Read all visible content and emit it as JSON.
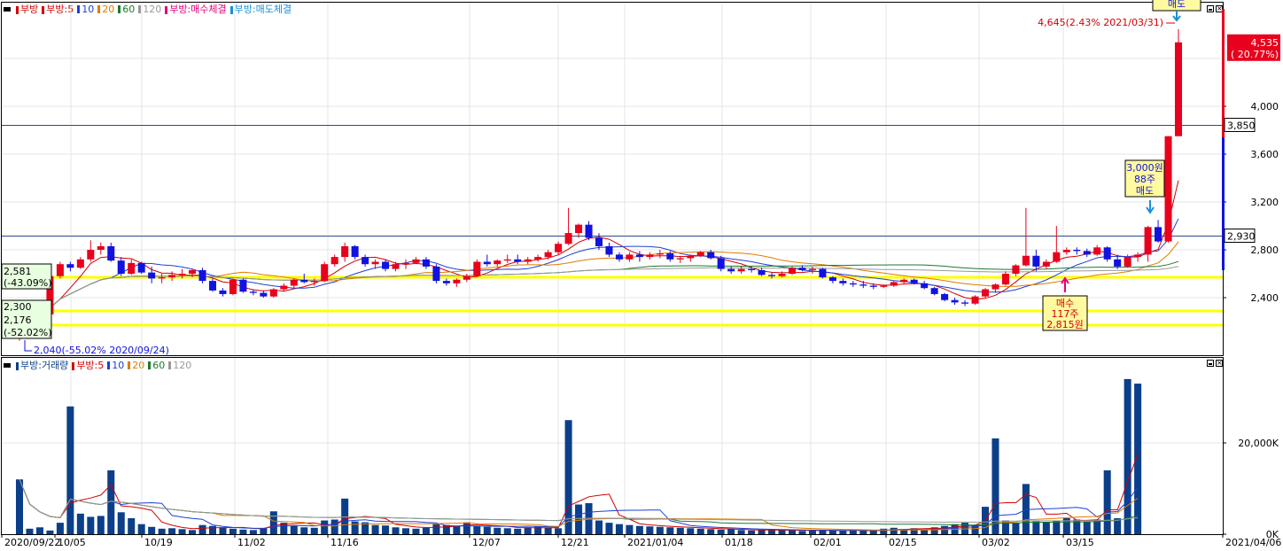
{
  "legend_price": [
    {
      "label": "부방",
      "color": "#d40000"
    },
    {
      "label": "부방:5",
      "color": "#d40000"
    },
    {
      "label": "10",
      "color": "#1d3fd6"
    },
    {
      "label": "20",
      "color": "#e07b00"
    },
    {
      "label": "60",
      "color": "#1a7a2a"
    },
    {
      "label": "120",
      "color": "#999999"
    },
    {
      "label": "부방:매수체결",
      "color": "#e0007a"
    },
    {
      "label": "부방:매도체결",
      "color": "#1a8fd6"
    }
  ],
  "legend_volume": [
    {
      "label": "부방:거래량",
      "color": "#0b3f8a"
    },
    {
      "label": "부방:5",
      "color": "#d40000"
    },
    {
      "label": "10",
      "color": "#1d3fd6"
    },
    {
      "label": "20",
      "color": "#e07b00"
    },
    {
      "label": "60",
      "color": "#1a7a2a"
    },
    {
      "label": "120",
      "color": "#999999"
    }
  ],
  "price_axis": {
    "ticks": [
      "4,000",
      "3,600",
      "3,200",
      "2,800",
      "2,400"
    ]
  },
  "price_markers": {
    "current": {
      "text": "4,535",
      "sub": "( 20.77%)"
    },
    "line1": "3,850",
    "line2": "2,930"
  },
  "left_boxes": [
    {
      "line1": "2,581",
      "line2": "(-43.09%)"
    },
    {
      "line1": "2,300",
      "line2": "2,176",
      "line3": "(-52.02%)"
    }
  ],
  "annotations": {
    "high": "4,645(2.43% 2021/03/31)",
    "low": "2,040(-55.02% 2020/09/24)",
    "sell_top": "매도",
    "sell_mid": [
      "3,000원",
      "88주",
      "매도"
    ],
    "buy": [
      "매수",
      "117주",
      "2,815원"
    ]
  },
  "volume_axis": {
    "ticks": [
      "20,000K",
      "0K"
    ]
  },
  "date_axis": [
    "2020/09/22",
    "10/05",
    "10/19",
    "11/02",
    "11/16",
    "12/07",
    "12/21",
    "2021/01/04",
    "01/18",
    "02/01",
    "02/15",
    "03/02",
    "03/15",
    "2021/04/06"
  ],
  "colors": {
    "up": "#e8001c",
    "down": "#1212e0",
    "vol": "#0b3f8a",
    "yellow": "#ffff00"
  },
  "chart_data": {
    "type": "candlestick",
    "description_units": "KRW",
    "candles": [
      [
        2160,
        2200,
        2040,
        2180
      ],
      [
        2180,
        2260,
        2160,
        2240
      ],
      [
        2240,
        2280,
        2200,
        2260
      ],
      [
        2260,
        2600,
        2250,
        2580
      ],
      [
        2580,
        2700,
        2560,
        2680
      ],
      [
        2680,
        2700,
        2620,
        2650
      ],
      [
        2650,
        2740,
        2640,
        2720
      ],
      [
        2720,
        2880,
        2700,
        2800
      ],
      [
        2800,
        2860,
        2760,
        2830
      ],
      [
        2830,
        2860,
        2700,
        2710
      ],
      [
        2710,
        2740,
        2580,
        2600
      ],
      [
        2600,
        2720,
        2590,
        2690
      ],
      [
        2690,
        2700,
        2600,
        2610
      ],
      [
        2610,
        2660,
        2520,
        2560
      ],
      [
        2560,
        2600,
        2520,
        2570
      ],
      [
        2570,
        2620,
        2540,
        2590
      ],
      [
        2590,
        2640,
        2560,
        2600
      ],
      [
        2600,
        2640,
        2570,
        2630
      ],
      [
        2630,
        2650,
        2520,
        2540
      ],
      [
        2540,
        2560,
        2450,
        2460
      ],
      [
        2460,
        2480,
        2410,
        2430
      ],
      [
        2430,
        2560,
        2420,
        2550
      ],
      [
        2550,
        2560,
        2440,
        2450
      ],
      [
        2450,
        2470,
        2420,
        2440
      ],
      [
        2440,
        2460,
        2400,
        2410
      ],
      [
        2410,
        2480,
        2400,
        2470
      ],
      [
        2470,
        2520,
        2450,
        2500
      ],
      [
        2500,
        2560,
        2470,
        2550
      ],
      [
        2550,
        2600,
        2520,
        2530
      ],
      [
        2530,
        2560,
        2500,
        2540
      ],
      [
        2540,
        2700,
        2530,
        2680
      ],
      [
        2680,
        2760,
        2660,
        2740
      ],
      [
        2740,
        2860,
        2700,
        2830
      ],
      [
        2830,
        2840,
        2720,
        2740
      ],
      [
        2740,
        2760,
        2660,
        2680
      ],
      [
        2680,
        2720,
        2640,
        2700
      ],
      [
        2700,
        2720,
        2620,
        2640
      ],
      [
        2640,
        2700,
        2620,
        2680
      ],
      [
        2680,
        2720,
        2640,
        2690
      ],
      [
        2690,
        2740,
        2680,
        2720
      ],
      [
        2720,
        2740,
        2640,
        2660
      ],
      [
        2660,
        2680,
        2520,
        2540
      ],
      [
        2540,
        2560,
        2500,
        2520
      ],
      [
        2520,
        2560,
        2490,
        2550
      ],
      [
        2550,
        2600,
        2530,
        2580
      ],
      [
        2580,
        2720,
        2570,
        2700
      ],
      [
        2700,
        2760,
        2660,
        2680
      ],
      [
        2680,
        2720,
        2660,
        2710
      ],
      [
        2710,
        2760,
        2690,
        2720
      ],
      [
        2720,
        2760,
        2680,
        2700
      ],
      [
        2700,
        2740,
        2680,
        2720
      ],
      [
        2720,
        2760,
        2700,
        2740
      ],
      [
        2740,
        2800,
        2720,
        2780
      ],
      [
        2780,
        2870,
        2760,
        2850
      ],
      [
        2850,
        3150,
        2840,
        2940
      ],
      [
        2940,
        3020,
        2900,
        3010
      ],
      [
        3010,
        3040,
        2880,
        2900
      ],
      [
        2900,
        2940,
        2800,
        2830
      ],
      [
        2830,
        2860,
        2740,
        2760
      ],
      [
        2760,
        2780,
        2700,
        2720
      ],
      [
        2720,
        2780,
        2700,
        2760
      ],
      [
        2760,
        2790,
        2700,
        2740
      ],
      [
        2740,
        2780,
        2720,
        2760
      ],
      [
        2760,
        2800,
        2730,
        2770
      ],
      [
        2770,
        2790,
        2700,
        2720
      ],
      [
        2720,
        2750,
        2690,
        2730
      ],
      [
        2730,
        2760,
        2700,
        2750
      ],
      [
        2750,
        2790,
        2740,
        2780
      ],
      [
        2780,
        2800,
        2720,
        2730
      ],
      [
        2730,
        2750,
        2620,
        2640
      ],
      [
        2640,
        2660,
        2600,
        2620
      ],
      [
        2620,
        2660,
        2600,
        2640
      ],
      [
        2640,
        2660,
        2610,
        2630
      ],
      [
        2630,
        2650,
        2580,
        2590
      ],
      [
        2590,
        2610,
        2560,
        2580
      ],
      [
        2580,
        2620,
        2570,
        2600
      ],
      [
        2600,
        2660,
        2590,
        2650
      ],
      [
        2650,
        2670,
        2620,
        2630
      ],
      [
        2630,
        2660,
        2600,
        2640
      ],
      [
        2640,
        2650,
        2560,
        2570
      ],
      [
        2570,
        2580,
        2520,
        2540
      ],
      [
        2540,
        2560,
        2500,
        2520
      ],
      [
        2520,
        2540,
        2490,
        2510
      ],
      [
        2510,
        2540,
        2480,
        2500
      ],
      [
        2500,
        2520,
        2470,
        2490
      ],
      [
        2490,
        2510,
        2480,
        2500
      ],
      [
        2500,
        2540,
        2490,
        2530
      ],
      [
        2530,
        2560,
        2510,
        2550
      ],
      [
        2550,
        2560,
        2510,
        2520
      ],
      [
        2520,
        2540,
        2470,
        2480
      ],
      [
        2480,
        2490,
        2420,
        2430
      ],
      [
        2430,
        2440,
        2370,
        2380
      ],
      [
        2380,
        2400,
        2340,
        2360
      ],
      [
        2360,
        2380,
        2330,
        2350
      ],
      [
        2350,
        2420,
        2340,
        2410
      ],
      [
        2410,
        2480,
        2400,
        2470
      ],
      [
        2470,
        2520,
        2440,
        2510
      ],
      [
        2510,
        2620,
        2500,
        2600
      ],
      [
        2600,
        2680,
        2580,
        2670
      ],
      [
        2670,
        3150,
        2660,
        2750
      ],
      [
        2750,
        2800,
        2620,
        2660
      ],
      [
        2660,
        2720,
        2640,
        2700
      ],
      [
        2700,
        3000,
        2690,
        2780
      ],
      [
        2780,
        2820,
        2760,
        2800
      ],
      [
        2800,
        2820,
        2760,
        2790
      ],
      [
        2790,
        2810,
        2740,
        2760
      ],
      [
        2760,
        2840,
        2750,
        2820
      ],
      [
        2820,
        2830,
        2700,
        2720
      ],
      [
        2720,
        2760,
        2640,
        2660
      ],
      [
        2660,
        2760,
        2650,
        2740
      ],
      [
        2740,
        2780,
        2700,
        2760
      ],
      [
        2760,
        3000,
        2700,
        2990
      ],
      [
        2990,
        3050,
        2860,
        2870
      ],
      [
        2870,
        3750,
        2860,
        3750
      ],
      [
        3750,
        4645,
        3920,
        4535
      ]
    ],
    "volume_k": [
      12000,
      1200,
      1500,
      800,
      2500,
      28000,
      4500,
      3800,
      4000,
      14000,
      4800,
      3500,
      2200,
      1600,
      1200,
      1300,
      1100,
      900,
      2000,
      1800,
      1400,
      1200,
      1000,
      900,
      1300,
      5000,
      2500,
      1800,
      1500,
      1400,
      3000,
      3200,
      7800,
      2800,
      2600,
      2000,
      1900,
      1500,
      1300,
      1200,
      1400,
      2200,
      2000,
      1800,
      2600,
      1800,
      1600,
      1400,
      1300,
      1200,
      1500,
      1700,
      1400,
      1300,
      25000,
      6500,
      6800,
      3000,
      2500,
      2200,
      2000,
      1800,
      1700,
      1600,
      1500,
      1400,
      1300,
      1200,
      1100,
      1000,
      1100,
      900,
      800,
      900,
      1000,
      900,
      800,
      700,
      800,
      900,
      800,
      700,
      900,
      800,
      700,
      1200,
      1400,
      1100,
      1300,
      1000,
      1500,
      1800,
      2200,
      2500,
      2000,
      6000,
      21000,
      3000,
      2500,
      11000,
      2800,
      2600,
      3000,
      3500,
      3200,
      2800,
      3200,
      14000,
      3500,
      34000,
      33000
    ]
  }
}
